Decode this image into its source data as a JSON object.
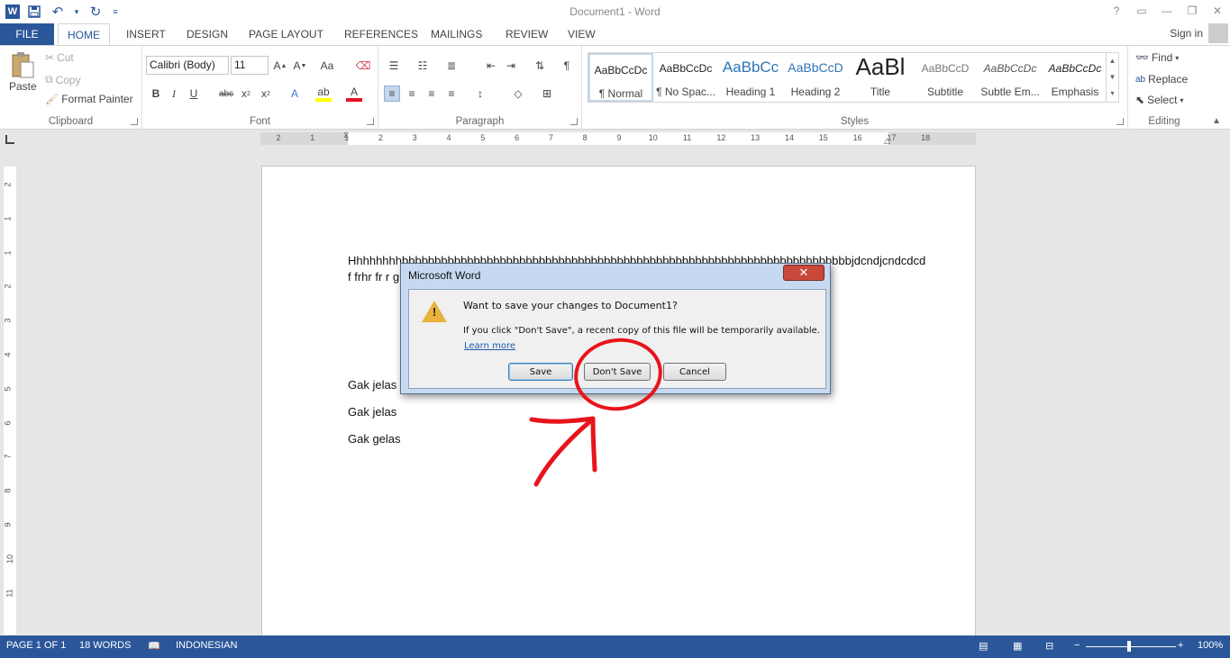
{
  "window": {
    "title": "Document1 - Word",
    "controls": [
      "?",
      "▭",
      "—",
      "❐",
      "✕"
    ]
  },
  "tabs": {
    "file": "FILE",
    "items": [
      "HOME",
      "INSERT",
      "DESIGN",
      "PAGE LAYOUT",
      "REFERENCES",
      "MAILINGS",
      "REVIEW",
      "VIEW"
    ],
    "active": "HOME",
    "signin": "Sign in"
  },
  "ribbon": {
    "clipboard": {
      "label": "Clipboard",
      "paste": "Paste",
      "cut": "Cut",
      "copy": "Copy",
      "format_painter": "Format Painter"
    },
    "font": {
      "label": "Font",
      "family": "Calibri (Body)",
      "size": "11"
    },
    "paragraph": {
      "label": "Paragraph"
    },
    "styles": {
      "label": "Styles",
      "items": [
        {
          "preview": "AaBbCcDc",
          "name": "¶ Normal"
        },
        {
          "preview": "AaBbCcDc",
          "name": "¶ No Spac..."
        },
        {
          "preview": "AaBbCc",
          "name": "Heading 1"
        },
        {
          "preview": "AaBbCcD",
          "name": "Heading 2"
        },
        {
          "preview": "AaBl",
          "name": "Title"
        },
        {
          "preview": "AaBbCcD",
          "name": "Subtitle"
        },
        {
          "preview": "AaBbCcDc",
          "name": "Subtle Em..."
        },
        {
          "preview": "AaBbCcDc",
          "name": "Emphasis"
        }
      ]
    },
    "editing": {
      "label": "Editing",
      "find": "Find",
      "replace": "Replace",
      "select": "Select"
    }
  },
  "ruler": {
    "h_numbers": [
      "2",
      "1",
      "1",
      "2",
      "3",
      "4",
      "5",
      "6",
      "7",
      "8",
      "9",
      "10",
      "11",
      "12",
      "13",
      "14",
      "15",
      "16",
      "17",
      "18"
    ],
    "v_numbers": [
      "2",
      "1",
      "1",
      "2",
      "3",
      "4",
      "5",
      "6",
      "7",
      "8",
      "9",
      "10",
      "11"
    ]
  },
  "document": {
    "line1": "Hhhhhhhhbbbbbbbbbbbbbbbbbbbbbbbbbbbbbbbbbbbbbbbbbbbbbbbbbbbbbbbbbbbbbbbbbbbbbjdcndjcndcdcd",
    "line2": "f frhr fr r g",
    "line3": "Gak jelas",
    "line4": "Gak jelas",
    "line5": "Gak gelas"
  },
  "dialog": {
    "title": "Microsoft Word",
    "close": "✕",
    "message": "Want to save your changes to Document1?",
    "sub": "If you click \"Don't Save\", a recent copy of this file will be temporarily available.",
    "link": "Learn more",
    "save": "Save",
    "dont_save": "Don't Save",
    "cancel": "Cancel"
  },
  "statusbar": {
    "page": "PAGE 1 OF 1",
    "words": "18 WORDS",
    "language": "INDONESIAN",
    "zoom": "100%"
  },
  "colors": {
    "accent": "#2b579a",
    "annotation": "#e8141b"
  }
}
